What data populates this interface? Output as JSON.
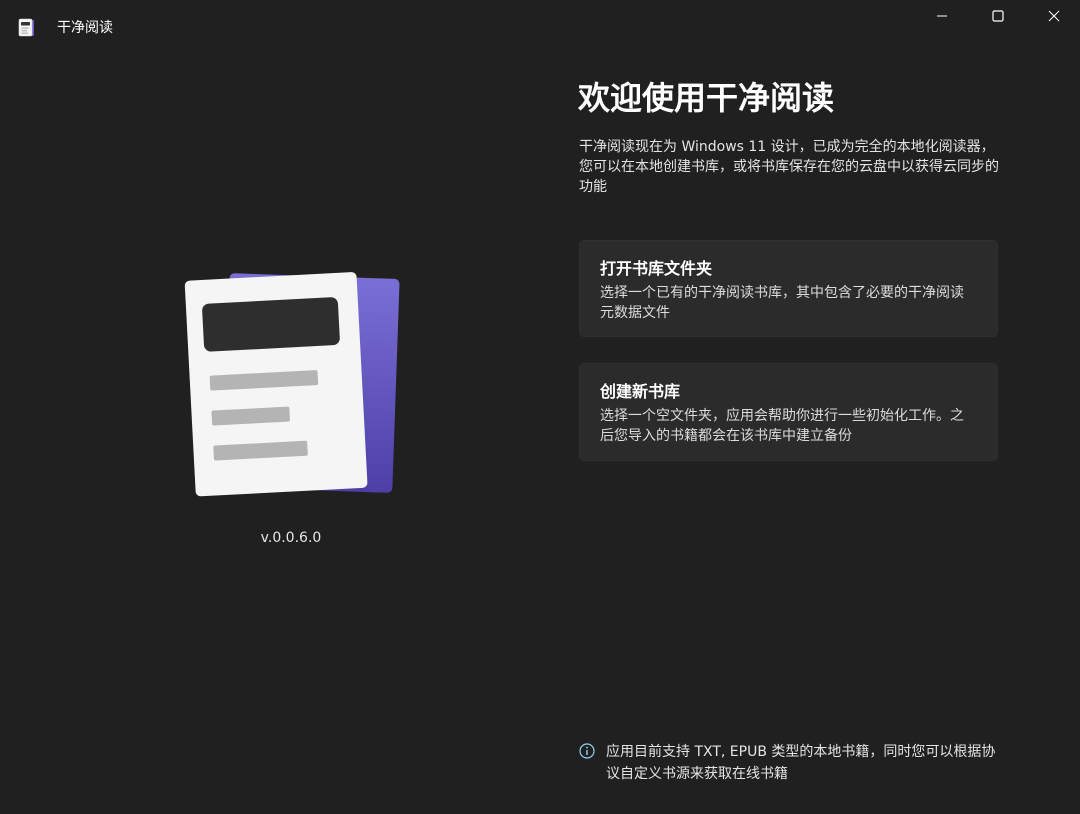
{
  "window": {
    "title": "干净阅读",
    "controls": {
      "minimize_icon": "minimize-icon",
      "maximize_icon": "maximize-icon",
      "close_icon": "close-icon"
    }
  },
  "hero": {
    "icon": "document-stack-icon",
    "version": "v.0.0.6.0"
  },
  "welcome": {
    "title": "欢迎使用干净阅读",
    "description": "干净阅读现在为 Windows 11 设计，已成为完全的本地化阅读器，您可以在本地创建书库，或将书库保存在您的云盘中以获得云同步的功能"
  },
  "cards": [
    {
      "title": "打开书库文件夹",
      "description": "选择一个已有的干净阅读书库，其中包含了必要的干净阅读元数据文件"
    },
    {
      "title": "创建新书库",
      "description": "选择一个空文件夹，应用会帮助你进行一些初始化工作。之后您导入的书籍都会在该书库中建立备份"
    }
  ],
  "footer": {
    "info_icon": "info-icon",
    "text": "应用目前支持 TXT, EPUB 类型的本地书籍，同时您可以根据协议自定义书源来获取在线书籍"
  },
  "colors": {
    "background": "#202020",
    "card": "#2b2b2b",
    "accent_purple": "#6b5fc7",
    "info_blue": "#8fd3f4"
  }
}
